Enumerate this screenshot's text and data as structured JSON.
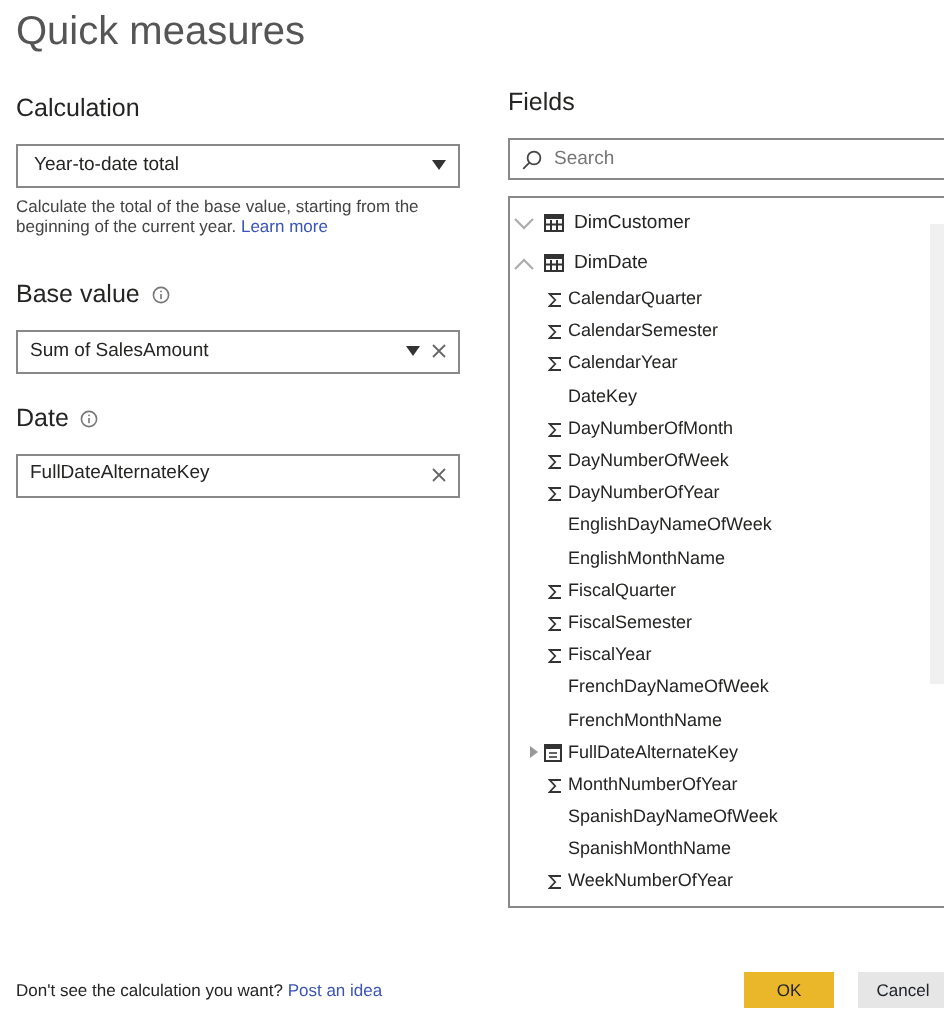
{
  "title": "Quick measures",
  "calculation": {
    "label": "Calculation",
    "value": "Year-to-date total"
  },
  "description": {
    "text": "Calculate the total of the base value, starting from the beginning of the current year.",
    "link": "Learn more"
  },
  "base_value": {
    "label": "Base value",
    "value": "Sum of SalesAmount"
  },
  "date": {
    "label": "Date",
    "value": "FullDateAlternateKey"
  },
  "fields": {
    "label": "Fields",
    "search": {
      "placeholder": "Search"
    },
    "tables": [
      {
        "name": "DimCustomer",
        "expanded": false
      },
      {
        "name": "DimDate",
        "expanded": true,
        "children": [
          {
            "name": "CalendarQuarter",
            "kind": "numeric"
          },
          {
            "name": "CalendarSemester",
            "kind": "numeric"
          },
          {
            "name": "CalendarYear",
            "kind": "numeric"
          },
          {
            "name": "DateKey",
            "kind": "text"
          },
          {
            "name": "DayNumberOfMonth",
            "kind": "numeric"
          },
          {
            "name": "DayNumberOfWeek",
            "kind": "numeric"
          },
          {
            "name": "DayNumberOfYear",
            "kind": "numeric"
          },
          {
            "name": "EnglishDayNameOfWeek",
            "kind": "text"
          },
          {
            "name": "EnglishMonthName",
            "kind": "text"
          },
          {
            "name": "FiscalQuarter",
            "kind": "numeric"
          },
          {
            "name": "FiscalSemester",
            "kind": "numeric"
          },
          {
            "name": "FiscalYear",
            "kind": "numeric"
          },
          {
            "name": "FrenchDayNameOfWeek",
            "kind": "text"
          },
          {
            "name": "FrenchMonthName",
            "kind": "text"
          },
          {
            "name": "FullDateAlternateKey",
            "kind": "date"
          },
          {
            "name": "MonthNumberOfYear",
            "kind": "numeric"
          },
          {
            "name": "SpanishDayNameOfWeek",
            "kind": "text"
          },
          {
            "name": "SpanishMonthName",
            "kind": "text"
          },
          {
            "name": "WeekNumberOfYear",
            "kind": "numeric"
          }
        ]
      }
    ]
  },
  "footer": {
    "text": "Don't see the calculation you want?",
    "link": "Post an idea"
  },
  "buttons": [
    {
      "label": "OK",
      "kind": "primary"
    },
    {
      "label": "Cancel",
      "kind": "secondary"
    }
  ]
}
